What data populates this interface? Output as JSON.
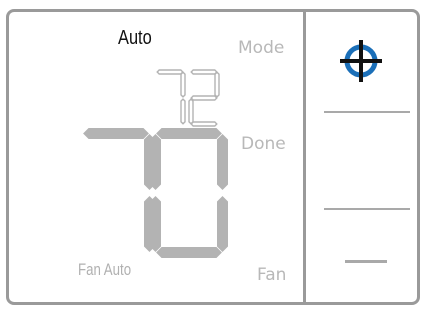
{
  "screen": {
    "mode": "Auto",
    "setpoint": "72",
    "current_temp": "70",
    "fan_status": "Fan Auto"
  },
  "buttons": {
    "mode_label": "Mode",
    "done_label": "Done",
    "fan_label": "Fan"
  },
  "side_panel": {
    "icon": "crosshair-icon",
    "icon_color": "#1b6fb8"
  },
  "colors": {
    "segment": "#b3b3b3",
    "frame": "#9a9a9a",
    "accent": "#1b6fb8"
  }
}
